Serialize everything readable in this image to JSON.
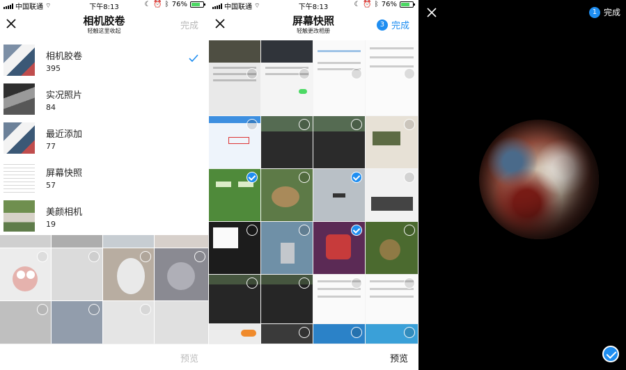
{
  "status_bar": {
    "carrier": "中国联通",
    "time": "下午8:13",
    "battery": "76%",
    "battery_level": 0.76
  },
  "album_picker": {
    "title": "相机胶卷",
    "subtitle": "轻触这里收起",
    "done_label": "完成",
    "albums": [
      {
        "name": "相机胶卷",
        "count": "395",
        "selected": true
      },
      {
        "name": "实况照片",
        "count": "84",
        "selected": false
      },
      {
        "name": "最近添加",
        "count": "77",
        "selected": false
      },
      {
        "name": "屏幕快照",
        "count": "57",
        "selected": false
      },
      {
        "name": "美颜相机",
        "count": "19",
        "selected": false
      }
    ],
    "preview_label": "预览"
  },
  "grid_view": {
    "title": "屏幕快照",
    "subtitle": "轻触更改相册",
    "selected_count": "3",
    "done_label": "完成",
    "preview_label": "预览"
  },
  "photo_viewer": {
    "selection_index": "1",
    "done_label": "完成"
  },
  "colors": {
    "accent": "#1f8ef1",
    "disabled_text": "#b9b9b9"
  }
}
